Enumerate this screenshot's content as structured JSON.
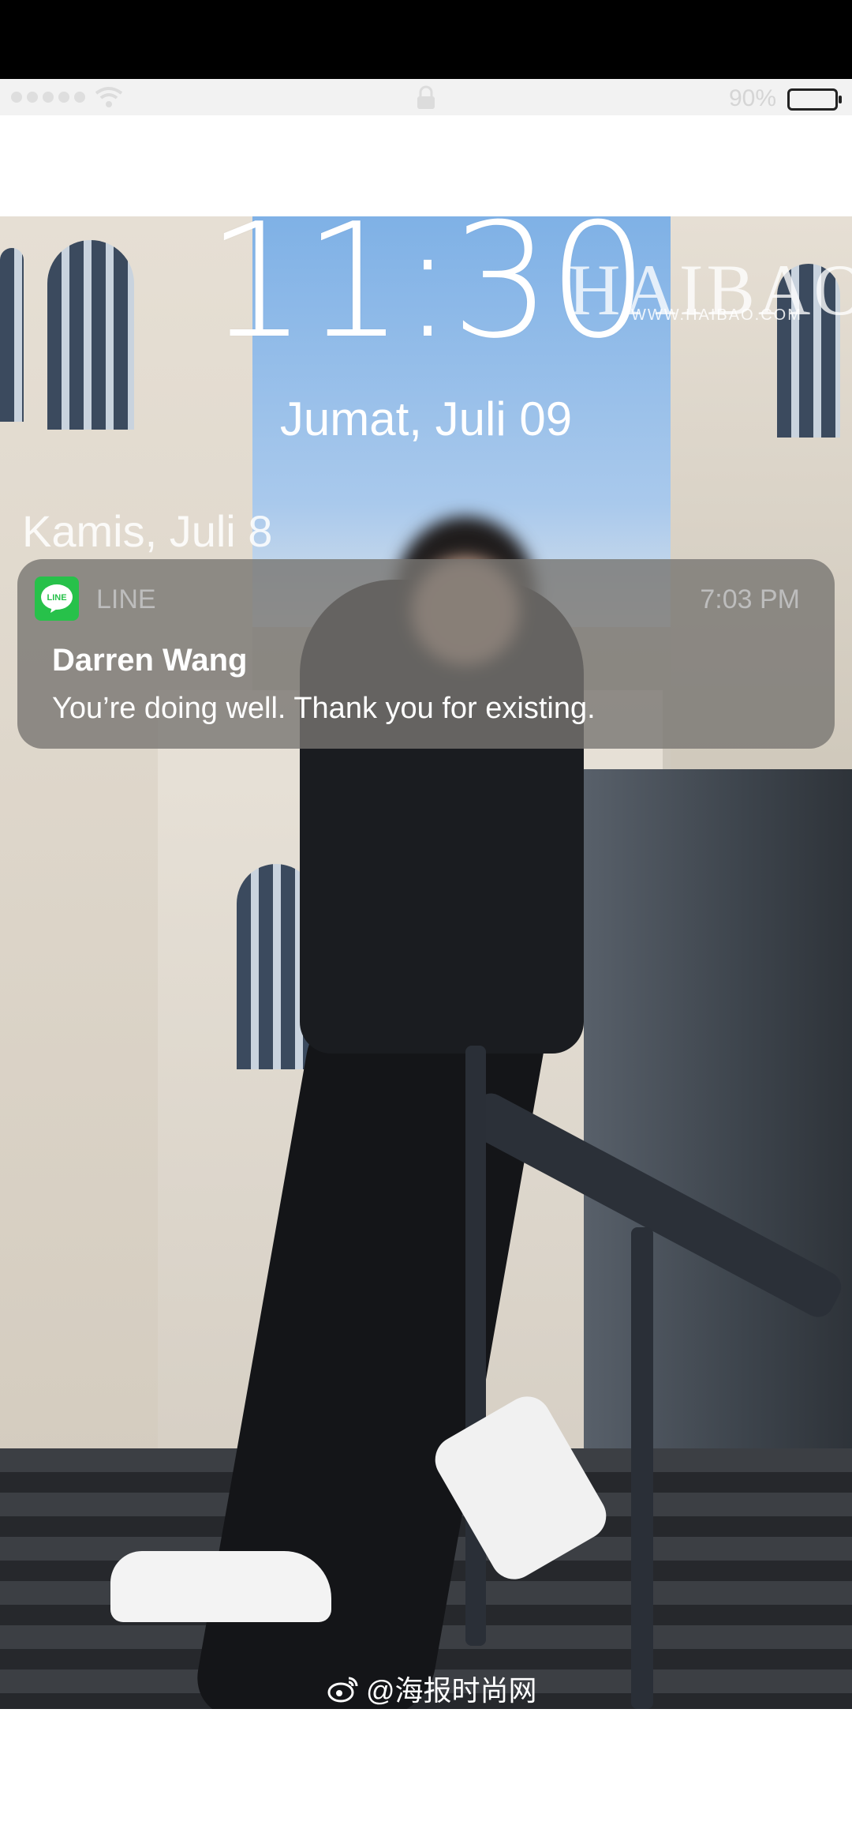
{
  "status_bar": {
    "battery_percent": "90%",
    "signal_dots": 5,
    "icons": [
      "signal-dots-icon",
      "wifi-icon",
      "lock-icon",
      "battery-icon"
    ]
  },
  "lock_screen": {
    "time": "11:30",
    "date": "Jumat, Juli 09",
    "previous_date": "Kamis, Juli 8"
  },
  "notification": {
    "app_icon": "line-app-icon",
    "app_icon_text": "LINE",
    "app_name": "LINE",
    "time": "7:03 PM",
    "sender": "Darren Wang",
    "message": "You’re doing well. Thank you for existing."
  },
  "wallpaper": {
    "watermark_top": "HAIBAO",
    "watermark_url": "WWW.HAIBAO.COM",
    "watermark_bottom": "@海报时尚网",
    "watermark_icon": "weibo-icon"
  },
  "colors": {
    "line_green": "#27c14a",
    "notification_bg": "rgba(120,118,114,0.80)"
  }
}
